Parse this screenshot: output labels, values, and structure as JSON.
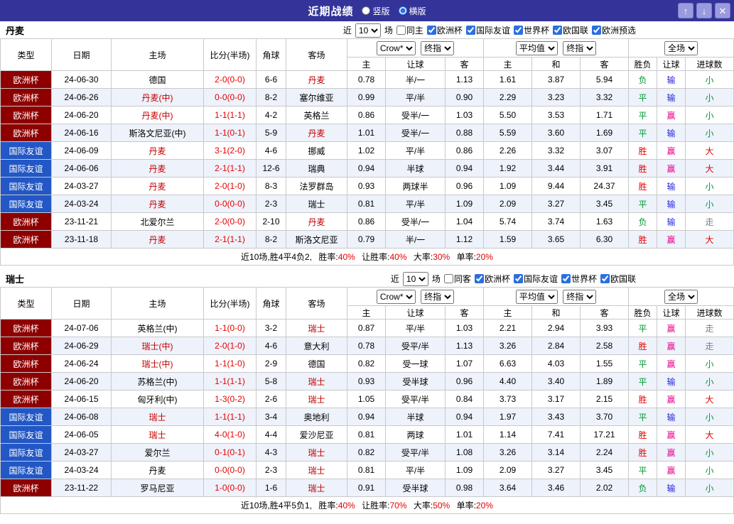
{
  "titlebar": {
    "title": "近期战绩",
    "layouts": [
      {
        "label": "竖版",
        "selected": false
      },
      {
        "label": "横版",
        "selected": true
      }
    ],
    "buttons": {
      "up": "↑",
      "down": "↓",
      "close": "✕"
    }
  },
  "table_headers": {
    "cols": [
      "类型",
      "日期",
      "主场",
      "比分(半场)",
      "角球",
      "客场"
    ],
    "sub": [
      "主",
      "让球",
      "客",
      "主",
      "和",
      "客",
      "胜负",
      "让球",
      "进球数"
    ],
    "selects": {
      "company": "Crow*",
      "final": "终指",
      "average": "平均值",
      "full": "全场"
    }
  },
  "colors": {
    "euro_cup": "#8e0000",
    "friendly": "#2257c5",
    "win_red": "#e60000",
    "draw_green": "#009933",
    "handicap_lose_blue": "#2626d9",
    "handicap_win_pink": "#e8008c",
    "titlebar": "#333399"
  },
  "sections": [
    {
      "team": "丹麦",
      "filter": {
        "near": "近",
        "count": "10",
        "unit": "场",
        "same": {
          "label": "同主",
          "checked": false
        },
        "competitions": [
          {
            "label": "欧洲杯",
            "checked": true
          },
          {
            "label": "国际友谊",
            "checked": true
          },
          {
            "label": "世界杯",
            "checked": true
          },
          {
            "label": "欧国联",
            "checked": true
          },
          {
            "label": "欧洲预选",
            "checked": true
          }
        ]
      },
      "rows": [
        {
          "type": "欧洲杯",
          "tc": "euro",
          "date": "24-06-30",
          "home": "德国",
          "hh": false,
          "score": "2-0(0-0)",
          "corner": "6-6",
          "away": "丹麦",
          "ah": true,
          "o1": "0.78",
          "oh": "半/一",
          "o2": "1.13",
          "a1": "1.61",
          "a2": "3.87",
          "a3": "5.94",
          "res": "负",
          "resc": "green",
          "hres": "输",
          "hresc": "blue",
          "goal": "小",
          "goalc": "green"
        },
        {
          "type": "欧洲杯",
          "tc": "euro",
          "date": "24-06-26",
          "home": "丹麦(中)",
          "hh": true,
          "score": "0-0(0-0)",
          "corner": "8-2",
          "away": "塞尔维亚",
          "ah": false,
          "o1": "0.99",
          "oh": "平/半",
          "o2": "0.90",
          "a1": "2.29",
          "a2": "3.23",
          "a3": "3.32",
          "res": "平",
          "resc": "green",
          "hres": "输",
          "hresc": "blue",
          "goal": "小",
          "goalc": "green"
        },
        {
          "type": "欧洲杯",
          "tc": "euro",
          "date": "24-06-20",
          "home": "丹麦(中)",
          "hh": true,
          "score": "1-1(1-1)",
          "corner": "4-2",
          "away": "英格兰",
          "ah": false,
          "o1": "0.86",
          "oh": "受半/一",
          "o2": "1.03",
          "a1": "5.50",
          "a2": "3.53",
          "a3": "1.71",
          "res": "平",
          "resc": "green",
          "hres": "赢",
          "hresc": "pink",
          "goal": "小",
          "goalc": "green"
        },
        {
          "type": "欧洲杯",
          "tc": "euro",
          "date": "24-06-16",
          "home": "斯洛文尼亚(中)",
          "hh": false,
          "score": "1-1(0-1)",
          "corner": "5-9",
          "away": "丹麦",
          "ah": true,
          "o1": "1.01",
          "oh": "受半/一",
          "o2": "0.88",
          "a1": "5.59",
          "a2": "3.60",
          "a3": "1.69",
          "res": "平",
          "resc": "green",
          "hres": "输",
          "hresc": "blue",
          "goal": "小",
          "goalc": "green"
        },
        {
          "type": "国际友谊",
          "tc": "friendly",
          "date": "24-06-09",
          "home": "丹麦",
          "hh": true,
          "score": "3-1(2-0)",
          "corner": "4-6",
          "away": "挪威",
          "ah": false,
          "o1": "1.02",
          "oh": "平/半",
          "o2": "0.86",
          "a1": "2.26",
          "a2": "3.32",
          "a3": "3.07",
          "res": "胜",
          "resc": "red",
          "hres": "赢",
          "hresc": "pink",
          "goal": "大",
          "goalc": "red"
        },
        {
          "type": "国际友谊",
          "tc": "friendly",
          "date": "24-06-06",
          "home": "丹麦",
          "hh": true,
          "score": "2-1(1-1)",
          "corner": "12-6",
          "away": "瑞典",
          "ah": false,
          "o1": "0.94",
          "oh": "半球",
          "o2": "0.94",
          "a1": "1.92",
          "a2": "3.44",
          "a3": "3.91",
          "res": "胜",
          "resc": "red",
          "hres": "赢",
          "hresc": "pink",
          "goal": "大",
          "goalc": "red"
        },
        {
          "type": "国际友谊",
          "tc": "friendly",
          "date": "24-03-27",
          "home": "丹麦",
          "hh": true,
          "score": "2-0(1-0)",
          "corner": "8-3",
          "away": "法罗群岛",
          "ah": false,
          "o1": "0.93",
          "oh": "两球半",
          "o2": "0.96",
          "a1": "1.09",
          "a2": "9.44",
          "a3": "24.37",
          "res": "胜",
          "resc": "red",
          "hres": "输",
          "hresc": "blue",
          "goal": "小",
          "goalc": "green"
        },
        {
          "type": "国际友谊",
          "tc": "friendly",
          "date": "24-03-24",
          "home": "丹麦",
          "hh": true,
          "score": "0-0(0-0)",
          "corner": "2-3",
          "away": "瑞士",
          "ah": false,
          "o1": "0.81",
          "oh": "平/半",
          "o2": "1.09",
          "a1": "2.09",
          "a2": "3.27",
          "a3": "3.45",
          "res": "平",
          "resc": "green",
          "hres": "输",
          "hresc": "blue",
          "goal": "小",
          "goalc": "green"
        },
        {
          "type": "欧洲杯",
          "tc": "euro",
          "date": "23-11-21",
          "home": "北爱尔兰",
          "hh": false,
          "score": "2-0(0-0)",
          "corner": "2-10",
          "away": "丹麦",
          "ah": true,
          "o1": "0.86",
          "oh": "受半/一",
          "o2": "1.04",
          "a1": "5.74",
          "a2": "3.74",
          "a3": "1.63",
          "res": "负",
          "resc": "green",
          "hres": "输",
          "hresc": "blue",
          "goal": "走",
          "goalc": "gray"
        },
        {
          "type": "欧洲杯",
          "tc": "euro",
          "date": "23-11-18",
          "home": "丹麦",
          "hh": true,
          "score": "2-1(1-1)",
          "corner": "8-2",
          "away": "斯洛文尼亚",
          "ah": false,
          "o1": "0.79",
          "oh": "半/一",
          "o2": "1.12",
          "a1": "1.59",
          "a2": "3.65",
          "a3": "6.30",
          "res": "胜",
          "resc": "red",
          "hres": "赢",
          "hresc": "pink",
          "goal": "大",
          "goalc": "red"
        }
      ],
      "summary": {
        "prefix": "近10场,胜4平4负2,",
        "stats": [
          {
            "label": "胜率:",
            "value": "40%"
          },
          {
            "label": "让胜率:",
            "value": "40%"
          },
          {
            "label": "大率:",
            "value": "30%"
          },
          {
            "label": "单率:",
            "value": "20%"
          }
        ]
      }
    },
    {
      "team": "瑞士",
      "filter": {
        "near": "近",
        "count": "10",
        "unit": "场",
        "same": {
          "label": "同客",
          "checked": false
        },
        "competitions": [
          {
            "label": "欧洲杯",
            "checked": true
          },
          {
            "label": "国际友谊",
            "checked": true
          },
          {
            "label": "世界杯",
            "checked": true
          },
          {
            "label": "欧国联",
            "checked": true
          }
        ]
      },
      "rows": [
        {
          "type": "欧洲杯",
          "tc": "euro",
          "date": "24-07-06",
          "home": "英格兰(中)",
          "hh": false,
          "score": "1-1(0-0)",
          "corner": "3-2",
          "away": "瑞士",
          "ah": true,
          "o1": "0.87",
          "oh": "平/半",
          "o2": "1.03",
          "a1": "2.21",
          "a2": "2.94",
          "a3": "3.93",
          "res": "平",
          "resc": "green",
          "hres": "赢",
          "hresc": "pink",
          "goal": "走",
          "goalc": "gray"
        },
        {
          "type": "欧洲杯",
          "tc": "euro",
          "date": "24-06-29",
          "home": "瑞士(中)",
          "hh": true,
          "score": "2-0(1-0)",
          "corner": "4-6",
          "away": "意大利",
          "ah": false,
          "o1": "0.78",
          "oh": "受平/半",
          "o2": "1.13",
          "a1": "3.26",
          "a2": "2.84",
          "a3": "2.58",
          "res": "胜",
          "resc": "red",
          "hres": "赢",
          "hresc": "pink",
          "goal": "走",
          "goalc": "gray"
        },
        {
          "type": "欧洲杯",
          "tc": "euro",
          "date": "24-06-24",
          "home": "瑞士(中)",
          "hh": true,
          "score": "1-1(1-0)",
          "corner": "2-9",
          "away": "德国",
          "ah": false,
          "o1": "0.82",
          "oh": "受一球",
          "o2": "1.07",
          "a1": "6.63",
          "a2": "4.03",
          "a3": "1.55",
          "res": "平",
          "resc": "green",
          "hres": "赢",
          "hresc": "pink",
          "goal": "小",
          "goalc": "green"
        },
        {
          "type": "欧洲杯",
          "tc": "euro",
          "date": "24-06-20",
          "home": "苏格兰(中)",
          "hh": false,
          "score": "1-1(1-1)",
          "corner": "5-8",
          "away": "瑞士",
          "ah": true,
          "o1": "0.93",
          "oh": "受半球",
          "o2": "0.96",
          "a1": "4.40",
          "a2": "3.40",
          "a3": "1.89",
          "res": "平",
          "resc": "green",
          "hres": "输",
          "hresc": "blue",
          "goal": "小",
          "goalc": "green"
        },
        {
          "type": "欧洲杯",
          "tc": "euro",
          "date": "24-06-15",
          "home": "匈牙利(中)",
          "hh": false,
          "score": "1-3(0-2)",
          "corner": "2-6",
          "away": "瑞士",
          "ah": true,
          "o1": "1.05",
          "oh": "受平/半",
          "o2": "0.84",
          "a1": "3.73",
          "a2": "3.17",
          "a3": "2.15",
          "res": "胜",
          "resc": "red",
          "hres": "赢",
          "hresc": "pink",
          "goal": "大",
          "goalc": "red"
        },
        {
          "type": "国际友谊",
          "tc": "friendly",
          "date": "24-06-08",
          "home": "瑞士",
          "hh": true,
          "score": "1-1(1-1)",
          "corner": "3-4",
          "away": "奥地利",
          "ah": false,
          "o1": "0.94",
          "oh": "半球",
          "o2": "0.94",
          "a1": "1.97",
          "a2": "3.43",
          "a3": "3.70",
          "res": "平",
          "resc": "green",
          "hres": "输",
          "hresc": "blue",
          "goal": "小",
          "goalc": "green"
        },
        {
          "type": "国际友谊",
          "tc": "friendly",
          "date": "24-06-05",
          "home": "瑞士",
          "hh": true,
          "score": "4-0(1-0)",
          "corner": "4-4",
          "away": "爱沙尼亚",
          "ah": false,
          "o1": "0.81",
          "oh": "两球",
          "o2": "1.01",
          "a1": "1.14",
          "a2": "7.41",
          "a3": "17.21",
          "res": "胜",
          "resc": "red",
          "hres": "赢",
          "hresc": "pink",
          "goal": "大",
          "goalc": "red"
        },
        {
          "type": "国际友谊",
          "tc": "friendly",
          "date": "24-03-27",
          "home": "爱尔兰",
          "hh": false,
          "score": "0-1(0-1)",
          "corner": "4-3",
          "away": "瑞士",
          "ah": true,
          "o1": "0.82",
          "oh": "受平/半",
          "o2": "1.08",
          "a1": "3.26",
          "a2": "3.14",
          "a3": "2.24",
          "res": "胜",
          "resc": "red",
          "hres": "赢",
          "hresc": "pink",
          "goal": "小",
          "goalc": "green"
        },
        {
          "type": "国际友谊",
          "tc": "friendly",
          "date": "24-03-24",
          "home": "丹麦",
          "hh": false,
          "score": "0-0(0-0)",
          "corner": "2-3",
          "away": "瑞士",
          "ah": true,
          "o1": "0.81",
          "oh": "平/半",
          "o2": "1.09",
          "a1": "2.09",
          "a2": "3.27",
          "a3": "3.45",
          "res": "平",
          "resc": "green",
          "hres": "赢",
          "hresc": "pink",
          "goal": "小",
          "goalc": "green"
        },
        {
          "type": "欧洲杯",
          "tc": "euro",
          "date": "23-11-22",
          "home": "罗马尼亚",
          "hh": false,
          "score": "1-0(0-0)",
          "corner": "1-6",
          "away": "瑞士",
          "ah": true,
          "o1": "0.91",
          "oh": "受半球",
          "o2": "0.98",
          "a1": "3.64",
          "a2": "3.46",
          "a3": "2.02",
          "res": "负",
          "resc": "green",
          "hres": "输",
          "hresc": "blue",
          "goal": "小",
          "goalc": "green"
        }
      ],
      "summary": {
        "prefix": "近10场,胜4平5负1,",
        "stats": [
          {
            "label": "胜率:",
            "value": "40%"
          },
          {
            "label": "让胜率:",
            "value": "70%"
          },
          {
            "label": "大率:",
            "value": "50%"
          },
          {
            "label": "单率:",
            "value": "20%"
          }
        ]
      }
    }
  ]
}
